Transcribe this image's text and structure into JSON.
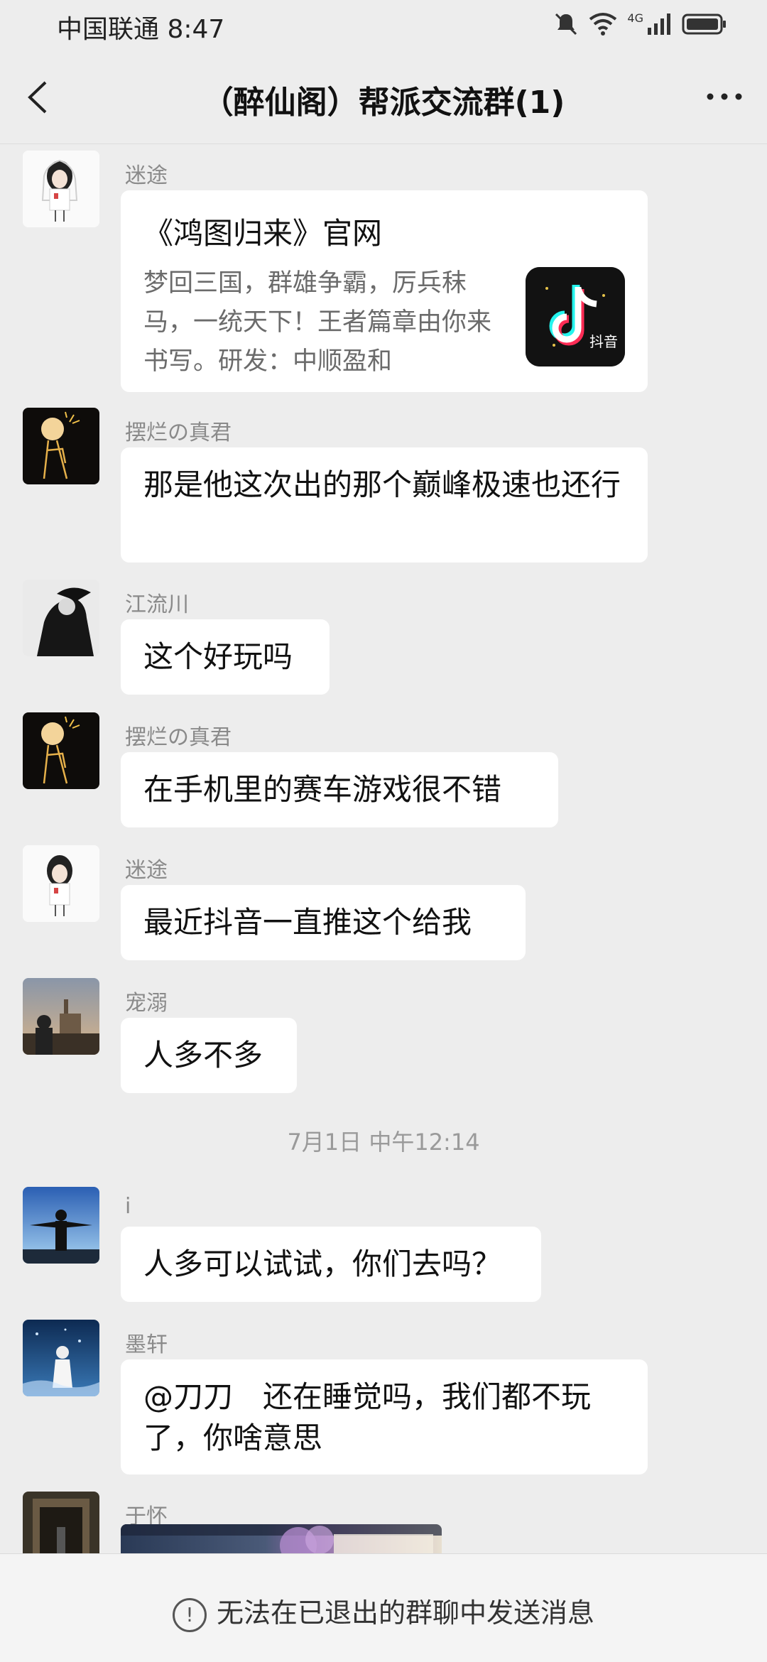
{
  "status_bar": {
    "carrier_time": "中国联通 8:47",
    "network": "4G"
  },
  "header": {
    "title": "（醉仙阁）帮派交流群(1)"
  },
  "messages": [
    {
      "sender": "迷途",
      "type": "card",
      "card": {
        "title": "《鸿图归来》官网",
        "description": "梦回三国，群雄争霸，厉兵秣马，一统天下！王者篇章由你来书写。研发：中顺盈和",
        "thumb_label": "抖音"
      }
    },
    {
      "sender": "摆烂の真君",
      "type": "text",
      "text": "那是他这次出的那个巅峰极速也还行"
    },
    {
      "sender": "江流川",
      "type": "text",
      "text": "这个好玩吗"
    },
    {
      "sender": "摆烂の真君",
      "type": "text",
      "text": "在手机里的赛车游戏很不错"
    },
    {
      "sender": "迷途",
      "type": "text",
      "text": "最近抖音一直推这个给我"
    },
    {
      "sender": "宠溺",
      "type": "text",
      "text": "人多不多"
    },
    {
      "sender": "i",
      "type": "text",
      "text": "人多可以试试，你们去吗？"
    },
    {
      "sender": "墨轩",
      "type": "text",
      "text": "@刀刀　还在睡觉吗，我们都不玩了，你啥意思"
    },
    {
      "sender": "于怀",
      "type": "image"
    }
  ],
  "timestamp": "7月1日 中午12:14",
  "footer": {
    "notice": "无法在已退出的群聊中发送消息"
  }
}
